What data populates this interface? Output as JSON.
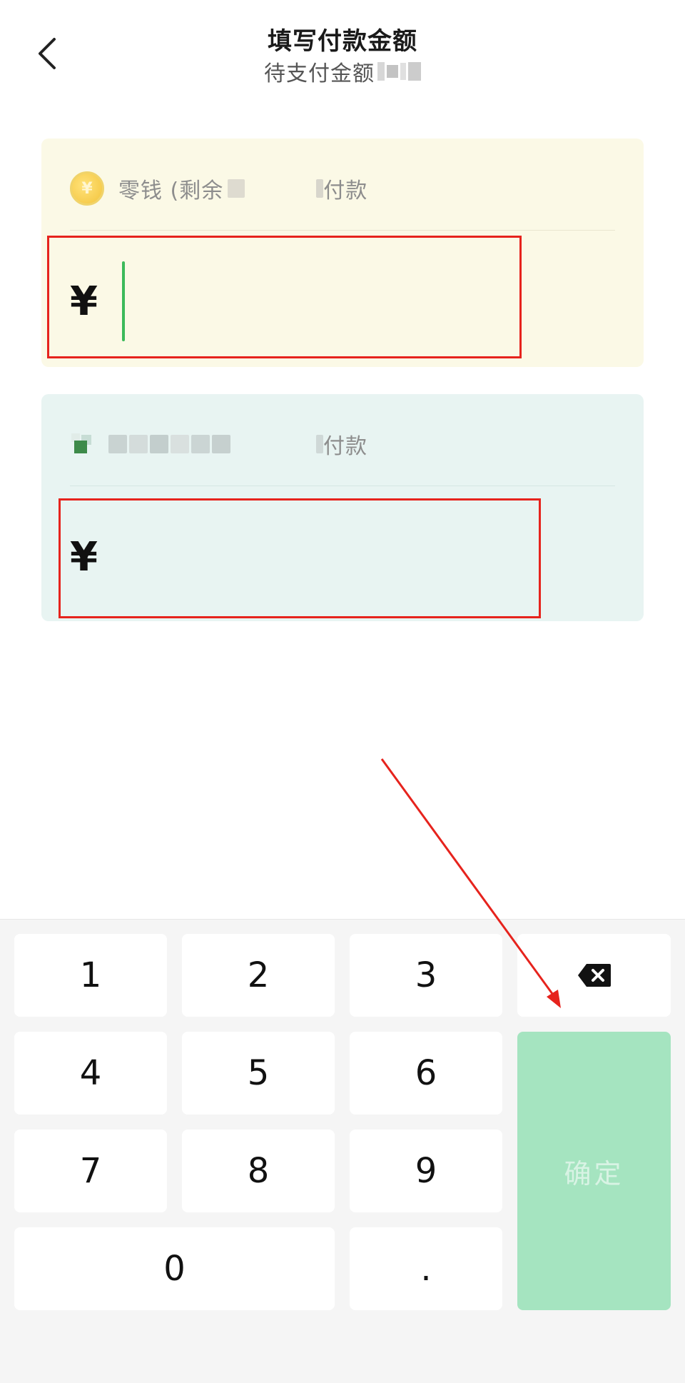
{
  "header": {
    "title": "填写付款金额",
    "subtitle": "待支付金额"
  },
  "change_card": {
    "label": "零钱 (剩余",
    "suffix": "付款",
    "currency_symbol": "¥",
    "amount_value": ""
  },
  "other_card": {
    "suffix": "付款",
    "currency_symbol": "¥",
    "amount_value": ""
  },
  "keypad": {
    "keys": [
      "1",
      "2",
      "3",
      "4",
      "5",
      "6",
      "7",
      "8",
      "9",
      "0",
      "."
    ],
    "confirm_label": "确定"
  },
  "colors": {
    "accent_green": "#3cba5a",
    "confirm_bg": "#a5e4c0",
    "annotation_red": "#e6231d",
    "change_card_bg": "#fbf9e6",
    "other_card_bg": "#e8f4f2"
  }
}
